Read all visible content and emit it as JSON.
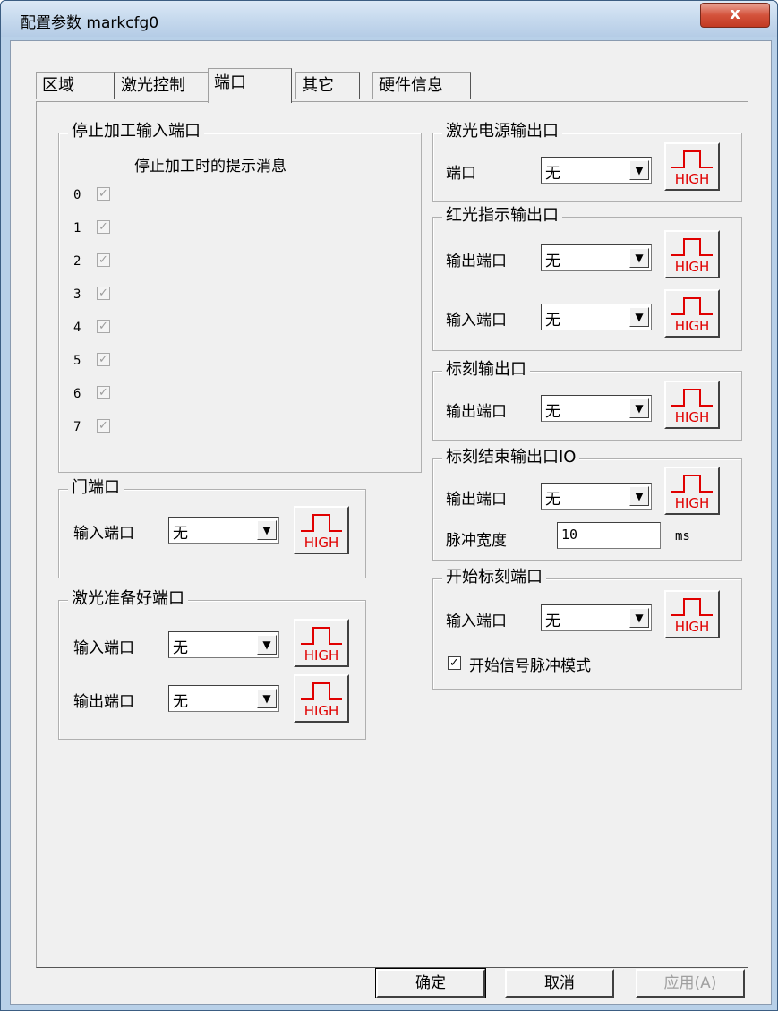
{
  "window": {
    "title": "配置参数 markcfg0",
    "close_label": "x"
  },
  "tabs": [
    "区域",
    "激光控制",
    "端口",
    "其它",
    "硬件信息"
  ],
  "active_tab": "端口",
  "stop_input": {
    "legend": "停止加工输入端口",
    "subtitle": "停止加工时的提示消息",
    "ports": [
      "0",
      "1",
      "2",
      "3",
      "4",
      "5",
      "6",
      "7"
    ]
  },
  "door_port": {
    "legend": "门端口",
    "input_label": "输入端口",
    "input_value": "无"
  },
  "laser_ready": {
    "legend": "激光准备好端口",
    "input_label": "输入端口",
    "input_value": "无",
    "output_label": "输出端口",
    "output_value": "无"
  },
  "laser_power": {
    "legend": "激光电源输出口",
    "port_label": "端口",
    "port_value": "无"
  },
  "red_light": {
    "legend": "红光指示输出口",
    "output_label": "输出端口",
    "output_value": "无",
    "input_label": "输入端口",
    "input_value": "无"
  },
  "mark_output": {
    "legend": "标刻输出口",
    "output_label": "输出端口",
    "output_value": "无"
  },
  "mark_end": {
    "legend": "标刻结束输出口IO",
    "output_label": "输出端口",
    "output_value": "无",
    "pulse_label": "脉冲宽度",
    "pulse_value": "10",
    "pulse_unit": "ms"
  },
  "start_mark": {
    "legend": "开始标刻端口",
    "input_label": "输入端口",
    "input_value": "无",
    "pulse_mode_label": "开始信号脉冲模式",
    "pulse_mode_checked": true
  },
  "high_label": "HIGH",
  "buttons": {
    "ok": "确定",
    "cancel": "取消",
    "apply": "应用(A)"
  }
}
